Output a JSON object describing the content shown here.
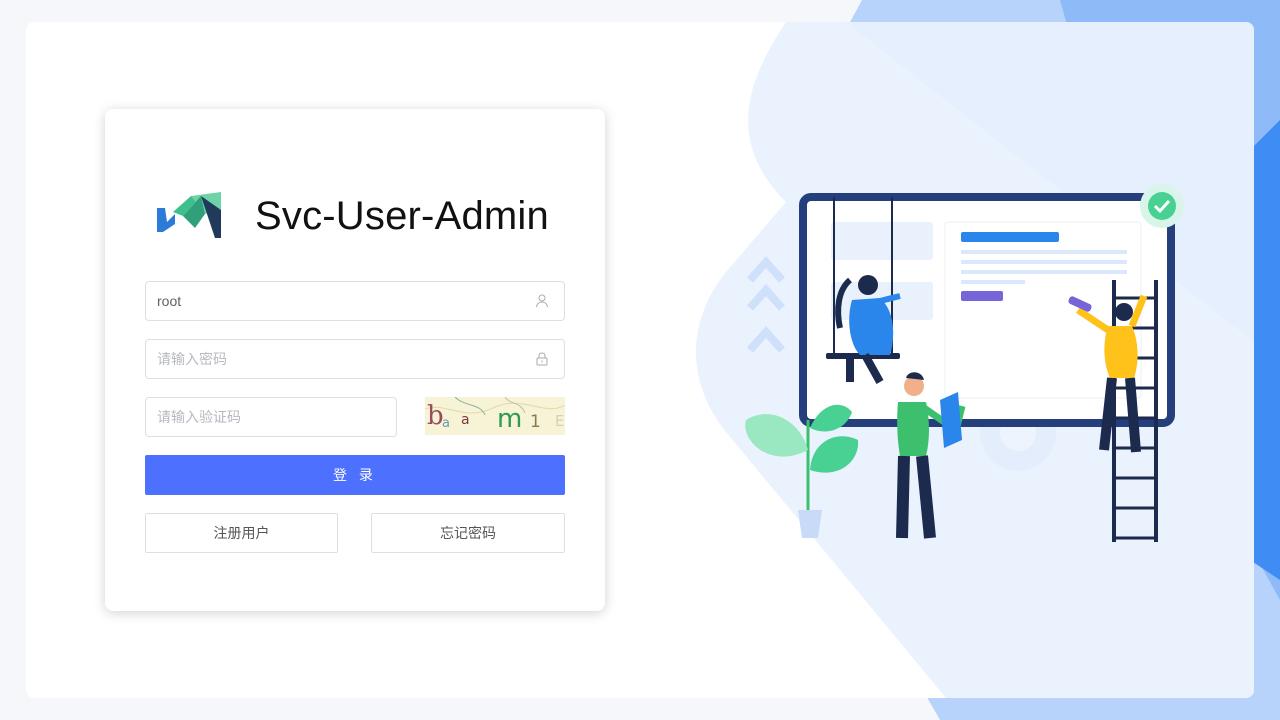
{
  "app": {
    "title": "Svc-User-Admin"
  },
  "form": {
    "username": {
      "value": "root",
      "icon": "user-icon"
    },
    "password": {
      "placeholder": "请输入密码",
      "icon": "lock-icon"
    },
    "captcha": {
      "placeholder": "请输入验证码",
      "image_text": "bam1"
    },
    "login_label": "登 录",
    "register_label": "注册用户",
    "forgot_label": "忘记密码"
  },
  "colors": {
    "primary": "#4d70ff",
    "brand_green": "#3fbf8f",
    "brand_blue": "#2d7bd8",
    "background": "#f5f7fa"
  }
}
